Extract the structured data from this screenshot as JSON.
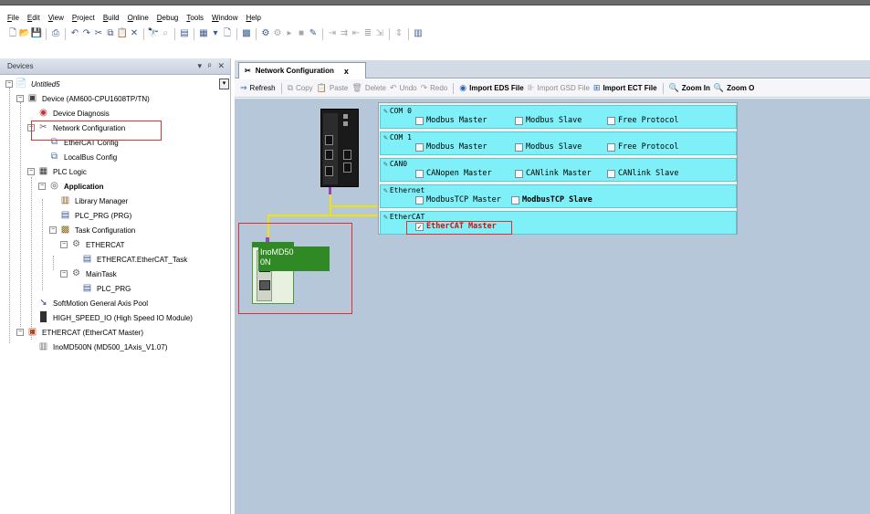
{
  "menu": [
    "File",
    "Edit",
    "View",
    "Project",
    "Build",
    "Online",
    "Debug",
    "Tools",
    "Window",
    "Help"
  ],
  "devices_pane": {
    "title": "Devices",
    "controls": [
      "▾",
      "ᵖ",
      "✕"
    ],
    "tree": [
      {
        "label": "Untitled5",
        "depth": 0,
        "exp": "−",
        "icon": "project-icon",
        "glyph": "📄",
        "style": "ital",
        "interactable": true
      },
      {
        "label": "Device (AM600-CPU1608TP/TN)",
        "depth": 1,
        "exp": "−",
        "icon": "device-icon",
        "glyph": "▣",
        "style": "",
        "interactable": true
      },
      {
        "label": "Device Diagnosis",
        "depth": 2,
        "exp": "",
        "icon": "diagnosis-icon",
        "glyph": "◉",
        "style": "",
        "interactable": true
      },
      {
        "label": "Network Configuration",
        "depth": 2,
        "exp": "−",
        "icon": "network-config-icon",
        "glyph": "✂",
        "style": "",
        "interactable": true
      },
      {
        "label": "EtherCAT Config",
        "depth": 3,
        "exp": "",
        "icon": "ethercat-config-icon",
        "glyph": "⧉",
        "style": "",
        "interactable": true
      },
      {
        "label": "LocalBus Config",
        "depth": 3,
        "exp": "",
        "icon": "localbus-config-icon",
        "glyph": "⧉",
        "style": "",
        "interactable": true
      },
      {
        "label": "PLC Logic",
        "depth": 2,
        "exp": "−",
        "icon": "plc-logic-icon",
        "glyph": "▦",
        "style": "",
        "interactable": true
      },
      {
        "label": "Application",
        "depth": 3,
        "exp": "−",
        "icon": "application-icon",
        "glyph": "◎",
        "style": "bold",
        "interactable": true
      },
      {
        "label": "Library Manager",
        "depth": 4,
        "exp": "",
        "icon": "library-manager-icon",
        "glyph": "▥",
        "style": "",
        "interactable": true
      },
      {
        "label": "PLC_PRG (PRG)",
        "depth": 4,
        "exp": "",
        "icon": "pou-icon",
        "glyph": "▤",
        "style": "",
        "interactable": true
      },
      {
        "label": "Task Configuration",
        "depth": 4,
        "exp": "−",
        "icon": "task-config-icon",
        "glyph": "▩",
        "style": "",
        "interactable": true
      },
      {
        "label": "ETHERCAT",
        "depth": 5,
        "exp": "−",
        "icon": "task-icon",
        "glyph": "⚙",
        "style": "",
        "interactable": true
      },
      {
        "label": "ETHERCAT.EtherCAT_Task",
        "depth": 6,
        "exp": "",
        "icon": "task-call-icon",
        "glyph": "▤",
        "style": "",
        "interactable": true
      },
      {
        "label": "MainTask",
        "depth": 5,
        "exp": "−",
        "icon": "task-icon",
        "glyph": "⚙",
        "style": "",
        "interactable": true
      },
      {
        "label": "PLC_PRG",
        "depth": 6,
        "exp": "",
        "icon": "task-call-icon",
        "glyph": "▤",
        "style": "",
        "interactable": true
      },
      {
        "label": "SoftMotion General Axis Pool",
        "depth": 2,
        "exp": "",
        "icon": "axis-pool-icon",
        "glyph": "↘",
        "style": "",
        "interactable": true
      },
      {
        "label": "HIGH_SPEED_IO (High Speed IO Module)",
        "depth": 2,
        "exp": "",
        "icon": "io-module-icon",
        "glyph": "█",
        "style": "",
        "interactable": true
      },
      {
        "label": "ETHERCAT (EtherCAT Master)",
        "depth": 1,
        "exp": "−",
        "icon": "ethercat-master-icon",
        "glyph": "▣",
        "style": "",
        "interactable": true
      },
      {
        "label": "InoMD500N (MD500_1Axis_V1.07)",
        "depth": 2,
        "exp": "",
        "icon": "slave-device-icon",
        "glyph": "▥",
        "style": "",
        "interactable": true
      }
    ]
  },
  "tab": {
    "title": "Network Configuration",
    "close": "x"
  },
  "editor_toolbar": [
    {
      "name": "refresh-button",
      "icon": "refresh-icon",
      "glyph": "⇒",
      "label": "Refresh",
      "enabled": true,
      "bold": false
    },
    {
      "name": "copy-button",
      "icon": "copy-icon",
      "glyph": "⧉",
      "label": "Copy",
      "enabled": false,
      "bold": false
    },
    {
      "name": "paste-button",
      "icon": "paste-icon",
      "glyph": "📋",
      "label": "Paste",
      "enabled": false,
      "bold": false
    },
    {
      "name": "delete-button",
      "icon": "delete-icon",
      "glyph": "🗑",
      "label": "Delete",
      "enabled": false,
      "bold": false
    },
    {
      "name": "undo-button",
      "icon": "undo-icon",
      "glyph": "↶",
      "label": "Undo",
      "enabled": false,
      "bold": false
    },
    {
      "name": "redo-button",
      "icon": "redo-icon",
      "glyph": "↷",
      "label": "Redo",
      "enabled": false,
      "bold": false
    },
    {
      "name": "import-eds-button",
      "icon": "import-eds-icon",
      "glyph": "◉",
      "label": "Import EDS File",
      "enabled": true,
      "bold": true
    },
    {
      "name": "import-gsd-button",
      "icon": "import-gsd-icon",
      "glyph": "⊪",
      "label": "Import GSD File",
      "enabled": false,
      "bold": false
    },
    {
      "name": "import-ect-button",
      "icon": "import-ect-icon",
      "glyph": "⊞",
      "label": "Import ECT File",
      "enabled": true,
      "bold": true
    },
    {
      "name": "zoom-in-button",
      "icon": "zoom-in-icon",
      "glyph": "🔍",
      "label": "Zoom In",
      "enabled": true,
      "bold": true
    },
    {
      "name": "zoom-out-button",
      "icon": "zoom-out-icon",
      "glyph": "🔍",
      "label": "Zoom O",
      "enabled": true,
      "bold": true
    }
  ],
  "canvas": {
    "slave_label": "InoMD50\n0N",
    "sections": [
      {
        "header": "COM 0",
        "options": [
          {
            "label": "Modbus Master",
            "checked": false
          },
          {
            "label": "Modbus Slave",
            "checked": false
          },
          {
            "label": "Free Protocol",
            "checked": false
          }
        ]
      },
      {
        "header": "COM 1",
        "options": [
          {
            "label": "Modbus Master",
            "checked": false
          },
          {
            "label": "Modbus Slave",
            "checked": false
          },
          {
            "label": "Free Protocol",
            "checked": false
          }
        ]
      },
      {
        "header": "CAN0",
        "options": [
          {
            "label": "CANopen Master",
            "checked": false
          },
          {
            "label": "CANlink Master",
            "checked": false
          },
          {
            "label": "CANlink Slave",
            "checked": false
          }
        ]
      },
      {
        "header": "Ethernet",
        "options": [
          {
            "label": "ModbusTCP Master",
            "checked": false
          },
          {
            "label": "ModbusTCP Slave",
            "checked": false
          }
        ]
      },
      {
        "header": "EtherCAT",
        "options": [
          {
            "label": "EtherCAT Master",
            "checked": true
          }
        ]
      }
    ]
  },
  "colors": {
    "canvas_bg": "#b6c7d9",
    "section_bg": "#7ff0f8",
    "bus": "#f2e400",
    "slave_green": "#2f8a26",
    "highlight_red": "#e03030"
  }
}
